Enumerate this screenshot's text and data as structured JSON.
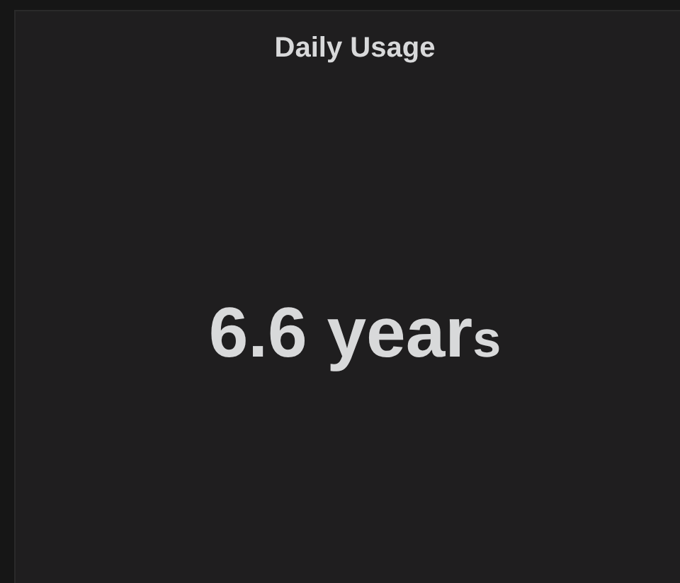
{
  "panel": {
    "title": "Daily Usage",
    "value": "6.6 year",
    "postfix": "s"
  }
}
